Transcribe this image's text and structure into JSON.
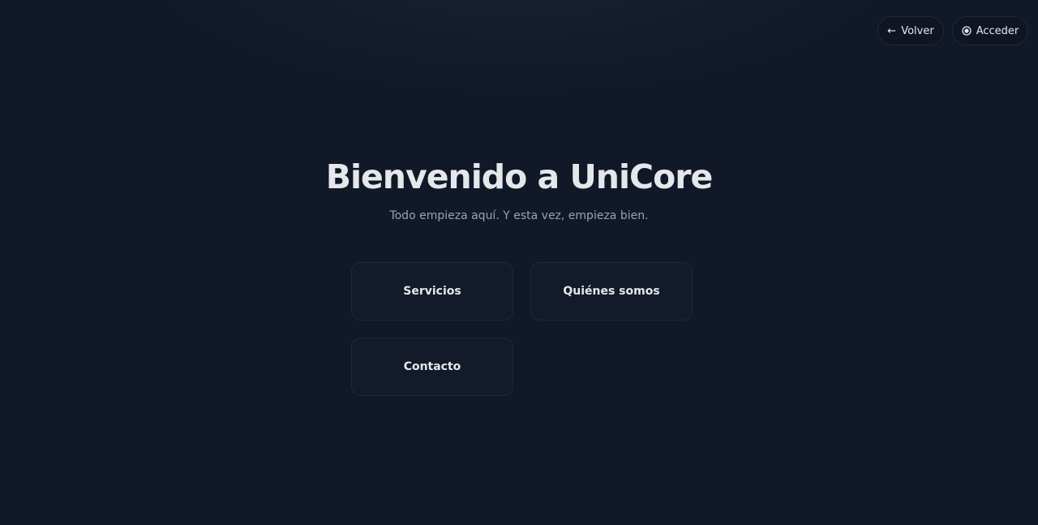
{
  "header": {
    "back_label": "Volver",
    "back_icon": "arrow-left-icon",
    "login_label": "Acceder",
    "login_icon": "radio-dot-icon"
  },
  "hero": {
    "title": "Bienvenido a UniCore",
    "subtitle": "Todo empieza aquí. Y esta vez, empieza bien."
  },
  "cards": [
    {
      "label": "Servicios"
    },
    {
      "label": "Quiénes somos"
    },
    {
      "label": "Contacto"
    }
  ],
  "colors": {
    "background": "#111827",
    "card_background": "#131a29",
    "border": "#1f2937",
    "text": "#e5e7eb",
    "muted_text": "#9ca3af"
  }
}
